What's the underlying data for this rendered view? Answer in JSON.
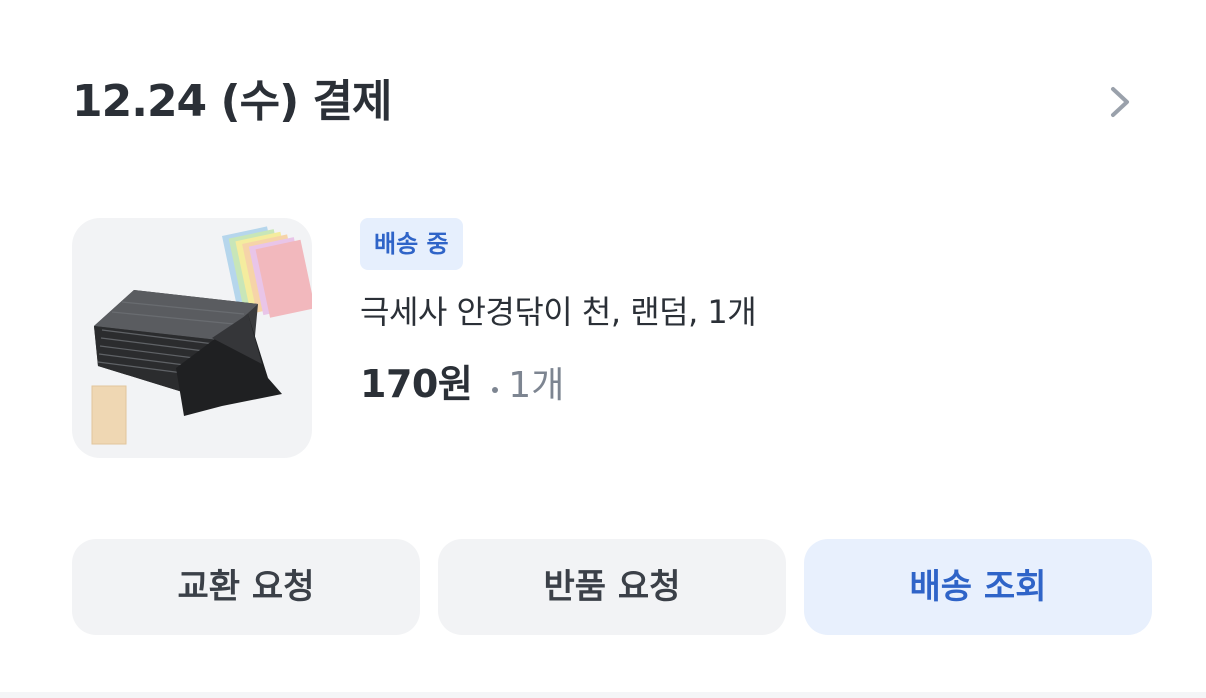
{
  "order": {
    "date_label": "12.24 (수) 결제"
  },
  "icons": {
    "chevron": "chevron-right-icon"
  },
  "product": {
    "status_badge": "배송 중",
    "name": "극세사 안경닦이 천, 랜덤, 1개",
    "price": "170원",
    "quantity": "1개",
    "image": "microfiber-cloth-product-image"
  },
  "actions": {
    "exchange_label": "교환 요청",
    "return_label": "반품 요청",
    "tracking_label": "배송 조회"
  },
  "colors": {
    "accent": "#2f64c8",
    "badge_bg": "#e6effd",
    "button_bg": "#f2f3f5",
    "text_primary": "#2b3037",
    "text_muted": "#7d8591"
  }
}
